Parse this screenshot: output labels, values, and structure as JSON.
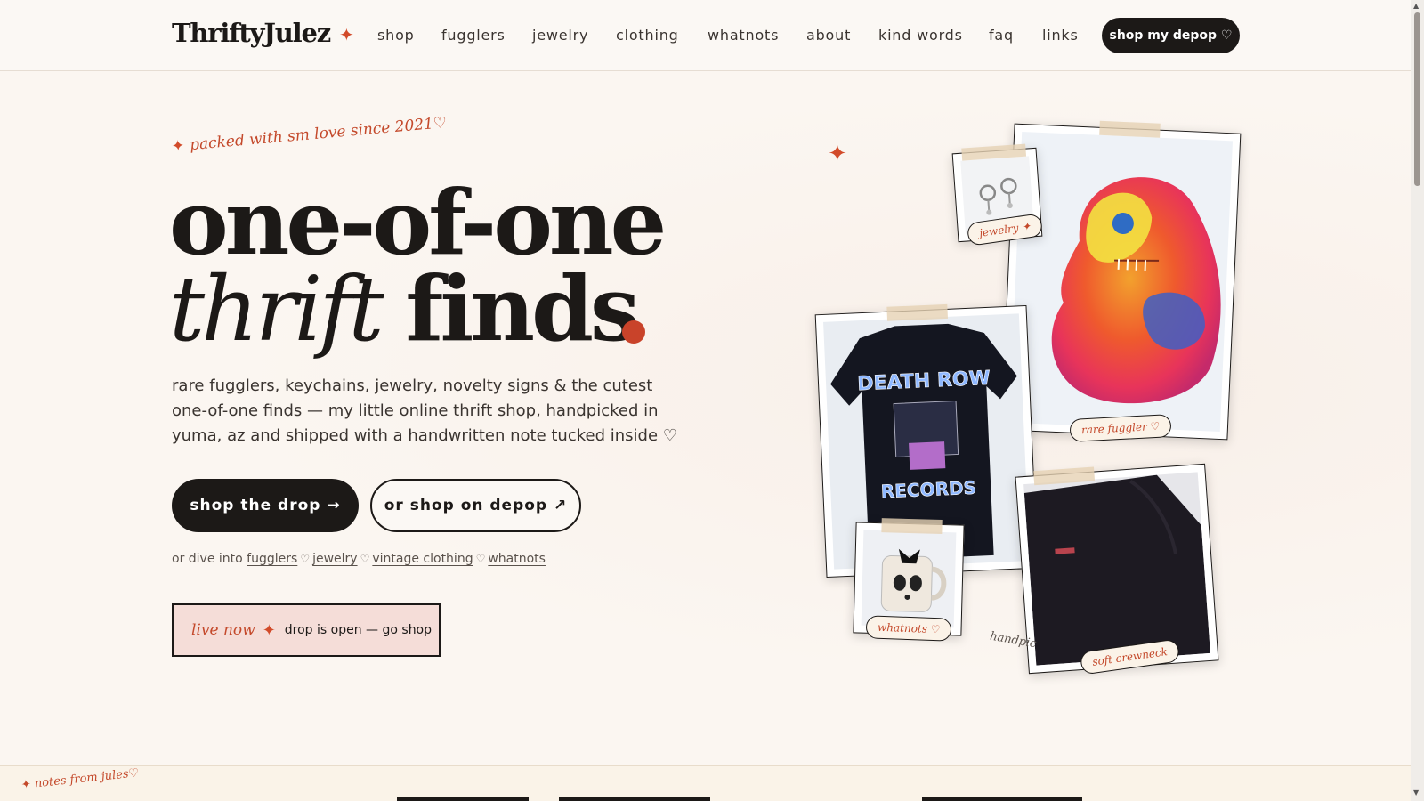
{
  "nav": {
    "logo": "ThriftyJulez",
    "links": [
      "shop",
      "fugglers",
      "jewelry",
      "clothing",
      "whatnots",
      "about",
      "kind words",
      "faq",
      "links"
    ],
    "depop_button": "shop my depop ♡"
  },
  "hero": {
    "tagline": "packed with sm love since 2021♡",
    "title_line1": "one-of-one",
    "title_line2_italic": "thrift",
    "title_line2_bold": "finds",
    "description": "rare fugglers, keychains, jewelry, novelty signs & the cutest one-of-one finds — my little online thrift shop, handpicked in yuma, az and shipped with a handwritten note tucked inside ♡",
    "primary_button": "shop the drop →",
    "secondary_button": "or shop on depop ↗",
    "dive_prefix": "or dive into",
    "dive_links": [
      "fugglers",
      "jewelry",
      "vintage clothing",
      "whatnots"
    ],
    "live_label": "live now",
    "live_text": "drop is open — go shop"
  },
  "gallery": {
    "chips": [
      "jewelry ✦",
      "rare fuggler ♡",
      "whatnots ♡",
      "soft crewneck"
    ],
    "handwritten_note": "handpic"
  },
  "footer_strip": {
    "label": "notes from jules♡"
  },
  "colors": {
    "accent": "#c9432a",
    "dark": "#1c1917",
    "background": "#fbf6f1",
    "live_bg": "#f5ddd8"
  }
}
